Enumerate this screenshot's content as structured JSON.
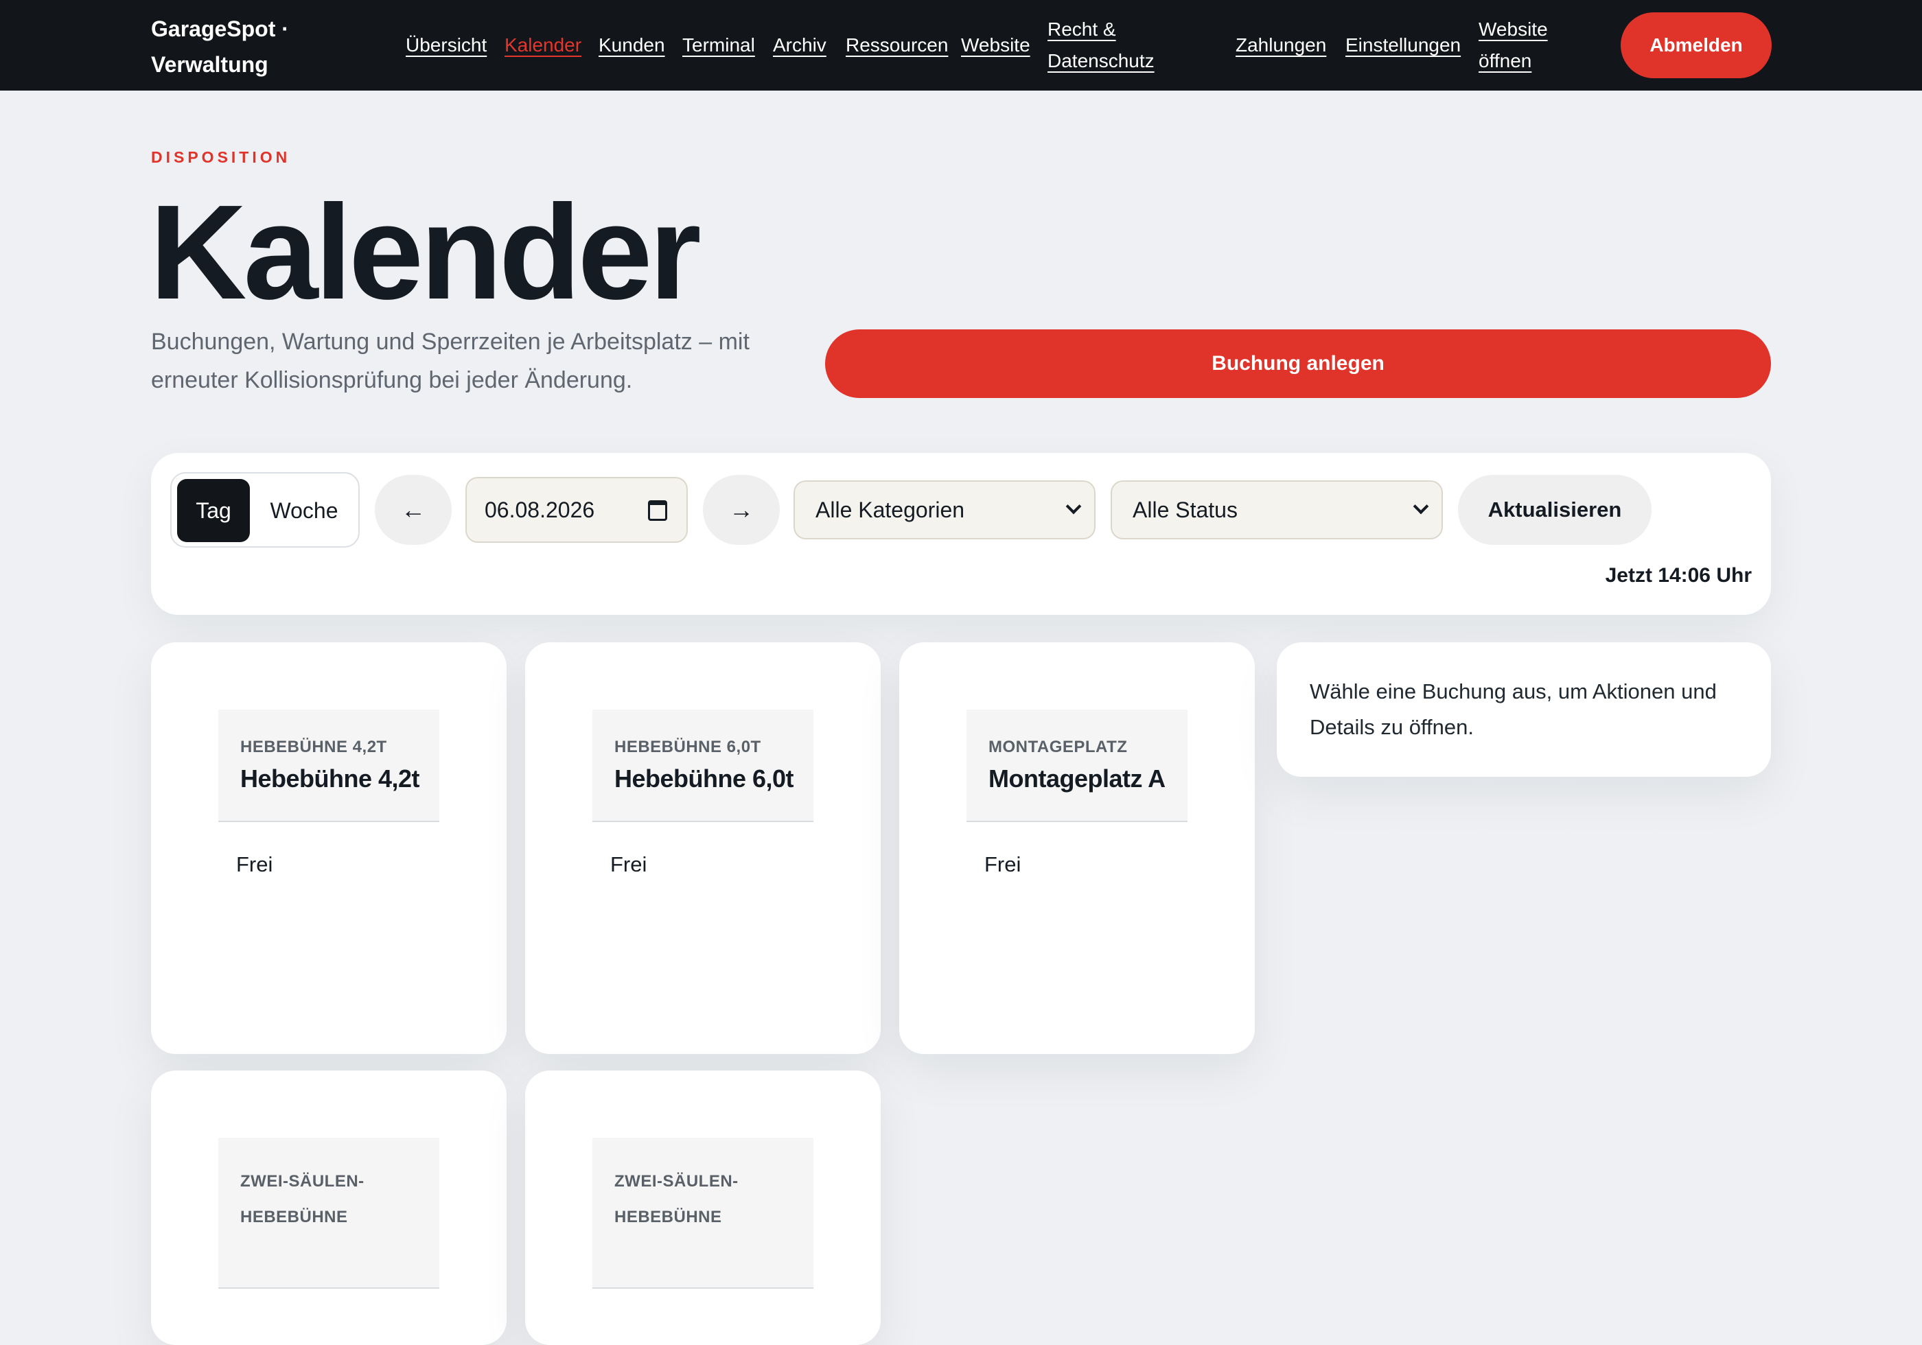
{
  "app": {
    "brand_line1": "GarageSpot ·",
    "brand_line2": "Verwaltung"
  },
  "nav": {
    "items": [
      {
        "label": "Übersicht",
        "active": false
      },
      {
        "label": "Kalender",
        "active": true
      },
      {
        "label": "Kunden",
        "active": false
      },
      {
        "label": "Terminal",
        "active": false
      },
      {
        "label": "Archiv",
        "active": false
      },
      {
        "label": "Ressourcen",
        "active": false
      },
      {
        "label": "Website",
        "active": false
      },
      {
        "label": "Recht & Datenschutz",
        "active": false
      },
      {
        "label": "Zahlungen",
        "active": false
      },
      {
        "label": "Einstellungen",
        "active": false
      },
      {
        "label": "Website öffnen",
        "active": false
      }
    ],
    "logout_label": "Abmelden"
  },
  "header": {
    "eyebrow": "DISPOSITION",
    "title": "Kalender",
    "subtitle": "Buchungen, Wartung und Sperrzeiten je Arbeitsplatz – mit erneuter Kollisionsprüfung bei jeder Änderung.",
    "create_label": "Buchung anlegen"
  },
  "toolbar": {
    "view_day": "Tag",
    "view_week": "Woche",
    "selected_view": "Tag",
    "prev_icon": "←",
    "next_icon": "→",
    "date_value": "06.08.2026",
    "category_value": "Alle Kategorien",
    "status_value": "Alle Status",
    "refresh_label": "Aktualisieren",
    "now_text": "Jetzt 14:06 Uhr"
  },
  "resources": [
    {
      "category": "HEBEBÜHNE 4,2T",
      "name": "Hebebühne 4,2t",
      "state": "Frei"
    },
    {
      "category": "HEBEBÜHNE 6,0T",
      "name": "Hebebühne 6,0t",
      "state": "Frei"
    },
    {
      "category": "MONTAGEPLATZ",
      "name": "Montageplatz A",
      "state": "Frei"
    },
    {
      "category": "ZWEI-SÄULEN-HEBEBÜHNE",
      "name": "",
      "state": ""
    },
    {
      "category": "ZWEI-SÄULEN-HEBEBÜHNE",
      "name": "",
      "state": ""
    }
  ],
  "detail": {
    "hint": "Wähle eine Buchung aus, um Aktionen und Details zu öffnen."
  },
  "colors": {
    "accent": "#e0332a",
    "topbar": "#121519",
    "background": "#eef0f3"
  }
}
